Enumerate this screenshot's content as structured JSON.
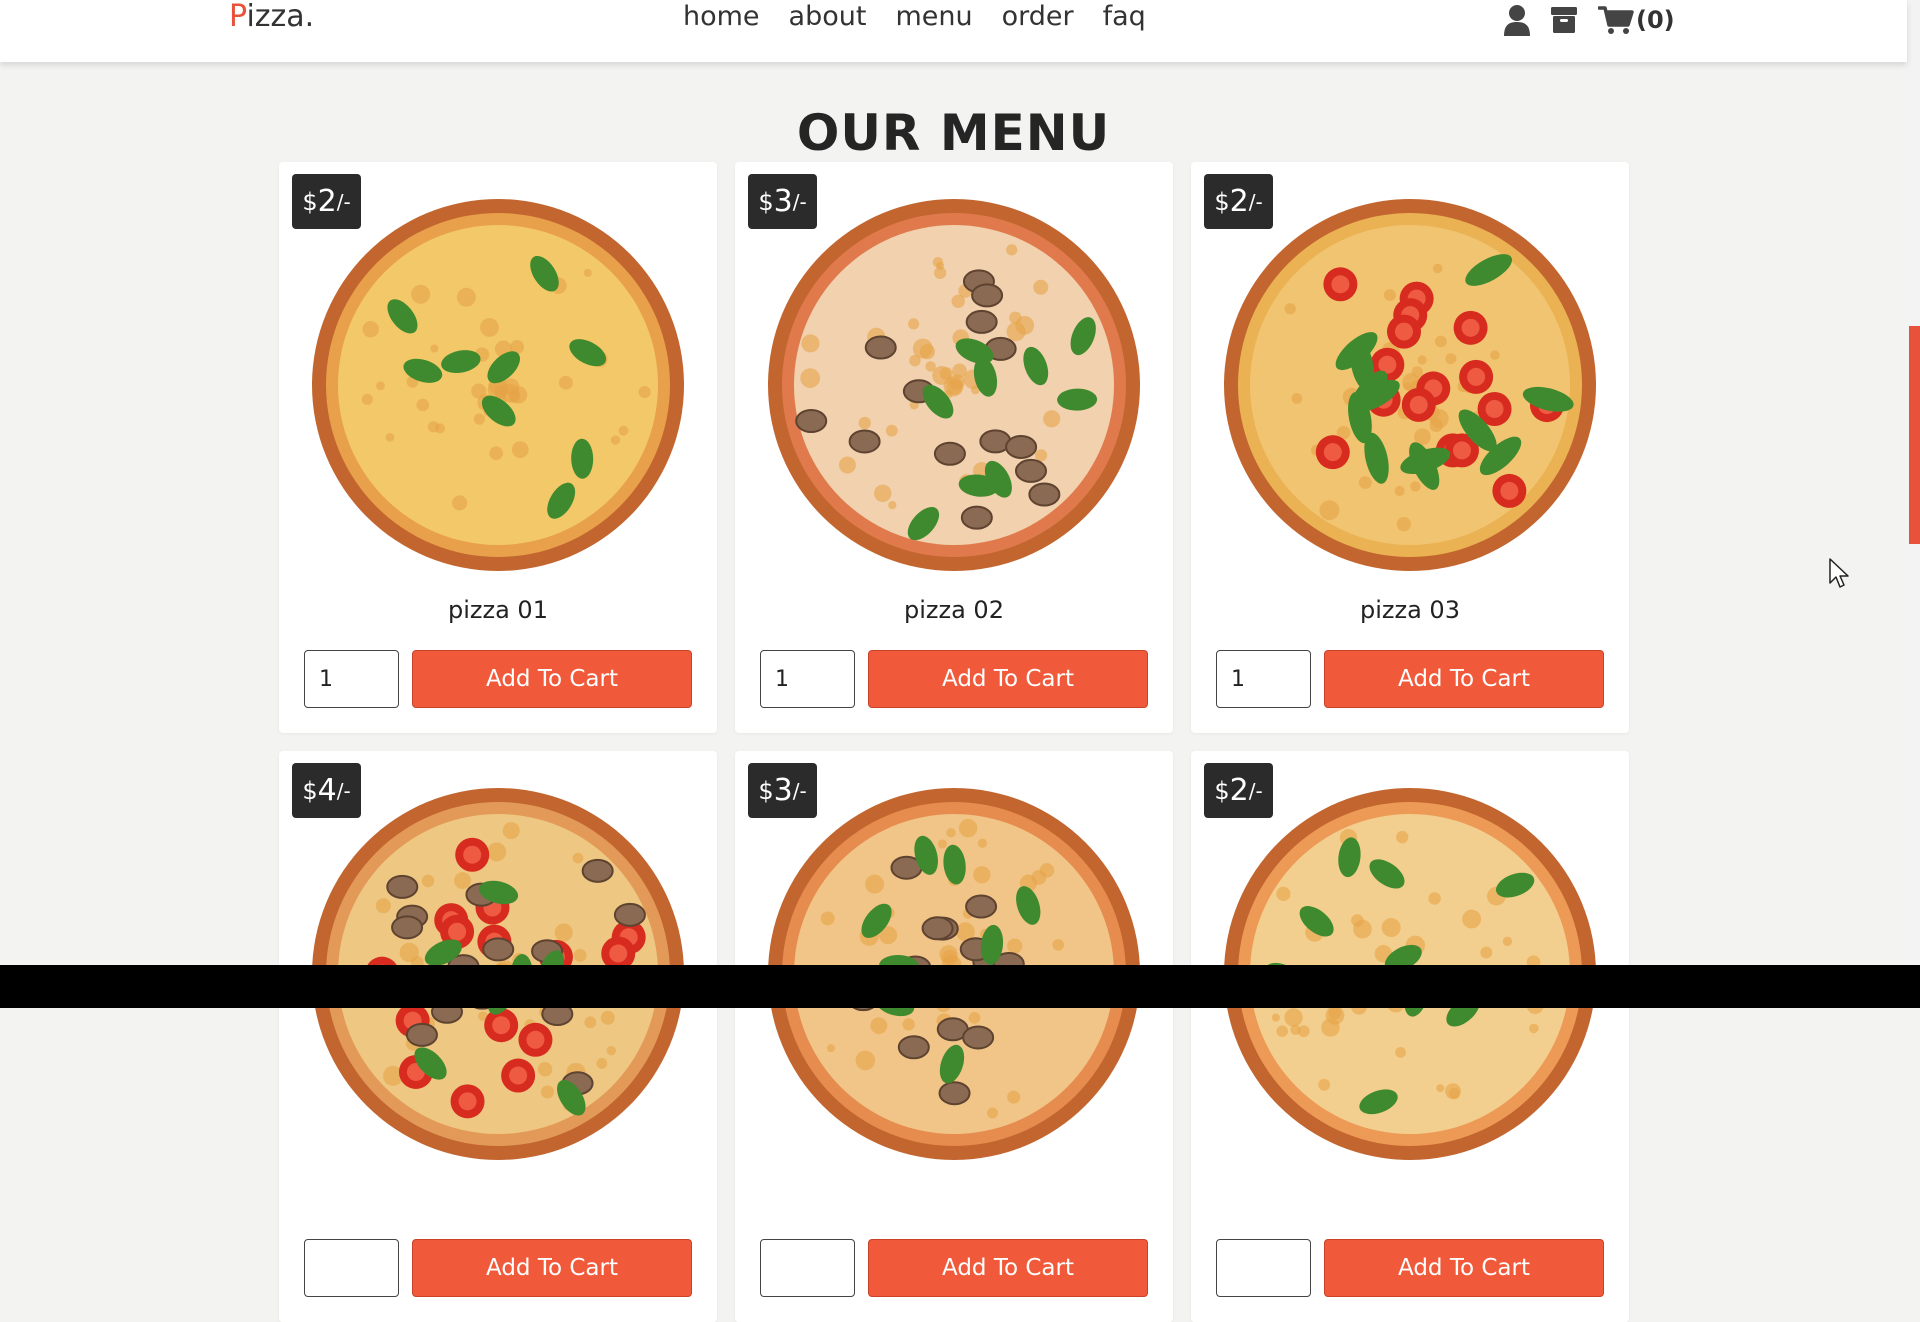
{
  "header": {
    "logo_first": "P",
    "logo_rest": "izza.",
    "nav": [
      "home",
      "about",
      "menu",
      "order",
      "faq"
    ],
    "cart_count": "(0)",
    "icons": [
      "user-icon",
      "box-icon",
      "shopping-cart-icon"
    ]
  },
  "menu": {
    "title": "OUR MENU",
    "add_label": "Add To Cart",
    "items": [
      {
        "price_symbol": "$",
        "price_value": "2",
        "price_suffix": "/-",
        "name": "pizza 01",
        "qty": "1",
        "style": "cheese-basil"
      },
      {
        "price_symbol": "$",
        "price_value": "3",
        "price_suffix": "/-",
        "name": "pizza 02",
        "qty": "1",
        "style": "mushroom"
      },
      {
        "price_symbol": "$",
        "price_value": "2",
        "price_suffix": "/-",
        "name": "pizza 03",
        "qty": "1",
        "style": "tomato-arugula"
      },
      {
        "price_symbol": "$",
        "price_value": "4",
        "price_suffix": "/-",
        "name": "",
        "qty": "",
        "style": "tomato-mushroom"
      },
      {
        "price_symbol": "$",
        "price_value": "3",
        "price_suffix": "/-",
        "name": "",
        "qty": "",
        "style": "mushroom-basil"
      },
      {
        "price_symbol": "$",
        "price_value": "2",
        "price_suffix": "/-",
        "name": "",
        "qty": "",
        "style": "margherita"
      }
    ]
  },
  "colors": {
    "accent": "#e8513a",
    "button": "#f05a3a",
    "price_badge": "#2b2b2b",
    "background": "#f3f3f1"
  }
}
